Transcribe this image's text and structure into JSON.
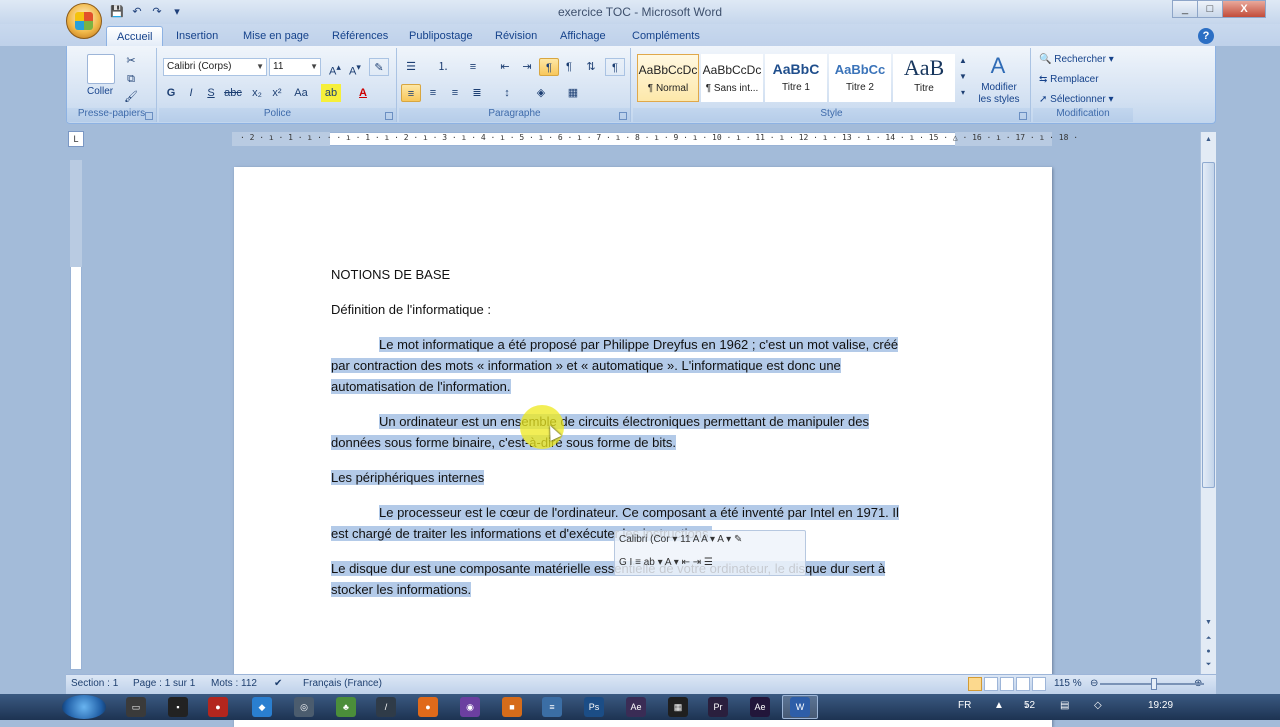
{
  "window": {
    "title": "exercice TOC - Microsoft Word",
    "controls": [
      "_",
      "□",
      "X"
    ]
  },
  "quick_access": [
    "save",
    "undo",
    "redo",
    "customize"
  ],
  "tabs": [
    "Accueil",
    "Insertion",
    "Mise en page",
    "Références",
    "Publipostage",
    "Révision",
    "Affichage",
    "Compléments"
  ],
  "ribbon": {
    "clipboard": {
      "paste": "Coller",
      "label": "Presse-papiers"
    },
    "font": {
      "name": "Calibri (Corps)",
      "size": "11",
      "label": "Police",
      "bold": "G",
      "italic": "I",
      "underline": "S"
    },
    "paragraph": {
      "label": "Paragraphe"
    },
    "styles": {
      "label": "Style",
      "items": [
        {
          "preview": "AaBbCcDc",
          "name": "¶ Normal"
        },
        {
          "preview": "AaBbCcDc",
          "name": "¶ Sans int..."
        },
        {
          "preview": "AaBbC",
          "name": "Titre 1"
        },
        {
          "preview": "AaBbCc",
          "name": "Titre 2"
        },
        {
          "preview": "AaB",
          "name": "Titre"
        }
      ],
      "modify": "Modifier\nles styles"
    },
    "edit": {
      "label": "Modification",
      "find": "Rechercher",
      "replace": "Remplacer",
      "select": "Sélectionner"
    }
  },
  "ruler": {
    "numbers": "· 2 · ı · 1 · ı · · · ı · 1 · ı · 2 · ı · 3 · ı · 4 · ı · 5 · ı · 6 · ı · 7 · ı · 8 · ı · 9 · ı · 10 · ı · 11 · ı · 12 · ı · 13 · ı · 14 · ı · 15 · △ · 16 · ı · 17 · ı · 18 ·"
  },
  "document": {
    "heading": "NOTIONS DE BASE",
    "subheading": "Définition de l'informatique :",
    "p1": [
      "Le mot informatique a été proposé par Philippe Dreyfus en 1962 ; c'est un mot valise, créé",
      "par contraction des mots « information » et « automatique ». L'informatique est donc une",
      "automatisation de l'information."
    ],
    "p2": [
      "Un ordinateur est un ensemble de circuits électroniques permettant de manipuler des",
      "données sous forme binaire, c'est-à-dire sous forme de bits."
    ],
    "p3": "Les périphériques internes",
    "p4": [
      "Le processeur est le cœur de l'ordinateur. Ce composant a été inventé par Intel en 1971. Il",
      "est chargé de traiter les informations et d'exécuter les instructions."
    ],
    "p5": [
      "Le disque dur est une composante matérielle essentielle de votre ordinateur, le disque dur sert à",
      "stocker les informations."
    ]
  },
  "mini_toolbar": {
    "font": "Calibri (Cor ▾",
    "size": "11",
    "row2": "G  I  ≡  ab ▾ A ▾  ⇤ ⇥ ☰"
  },
  "statusbar": {
    "section": "Section : 1",
    "page": "Page : 1 sur 1",
    "words": "Mots : 112",
    "language": "Français (France)",
    "zoom": "115 %"
  },
  "taskbar": {
    "lang": "FR",
    "volume": "52",
    "time": "19:29"
  },
  "colors": {
    "selection": "#b3cae8",
    "ribbon_text": "#15428b",
    "cursor_highlight": "#ede81e"
  }
}
